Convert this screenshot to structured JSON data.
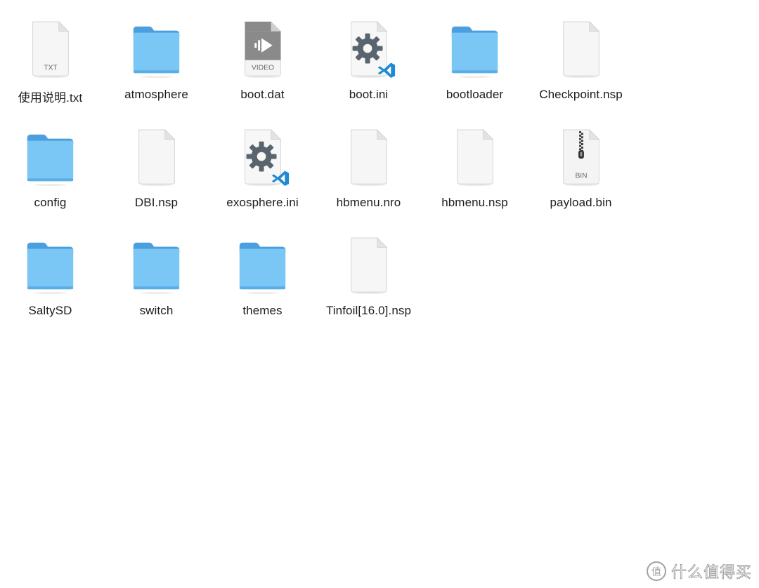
{
  "files": [
    {
      "name": "使用说明.txt",
      "kind": "doc",
      "badge": "TXT"
    },
    {
      "name": "atmosphere",
      "kind": "folder"
    },
    {
      "name": "boot.dat",
      "kind": "video",
      "badge": "VIDEO"
    },
    {
      "name": "boot.ini",
      "kind": "ini"
    },
    {
      "name": "bootloader",
      "kind": "folder"
    },
    {
      "name": "Checkpoint.nsp",
      "kind": "doc"
    },
    {
      "name": "config",
      "kind": "folder"
    },
    {
      "name": "DBI.nsp",
      "kind": "doc"
    },
    {
      "name": "exosphere.ini",
      "kind": "ini"
    },
    {
      "name": "hbmenu.nro",
      "kind": "doc"
    },
    {
      "name": "hbmenu.nsp",
      "kind": "doc"
    },
    {
      "name": "payload.bin",
      "kind": "bin",
      "badge": "BIN"
    },
    {
      "name": "SaltySD",
      "kind": "folder"
    },
    {
      "name": "switch",
      "kind": "folder"
    },
    {
      "name": "themes",
      "kind": "folder"
    },
    {
      "name": "Tinfoil[16.0].nsp",
      "kind": "doc"
    }
  ],
  "watermark": {
    "text": "什么值得买",
    "logo": "值"
  },
  "colors": {
    "folder_front": "#7ac6f5",
    "folder_back": "#4b9fdf",
    "label_text": "#1d1d1f",
    "vscode_blue": "#1f8ad2",
    "gear": "#5a646e"
  }
}
